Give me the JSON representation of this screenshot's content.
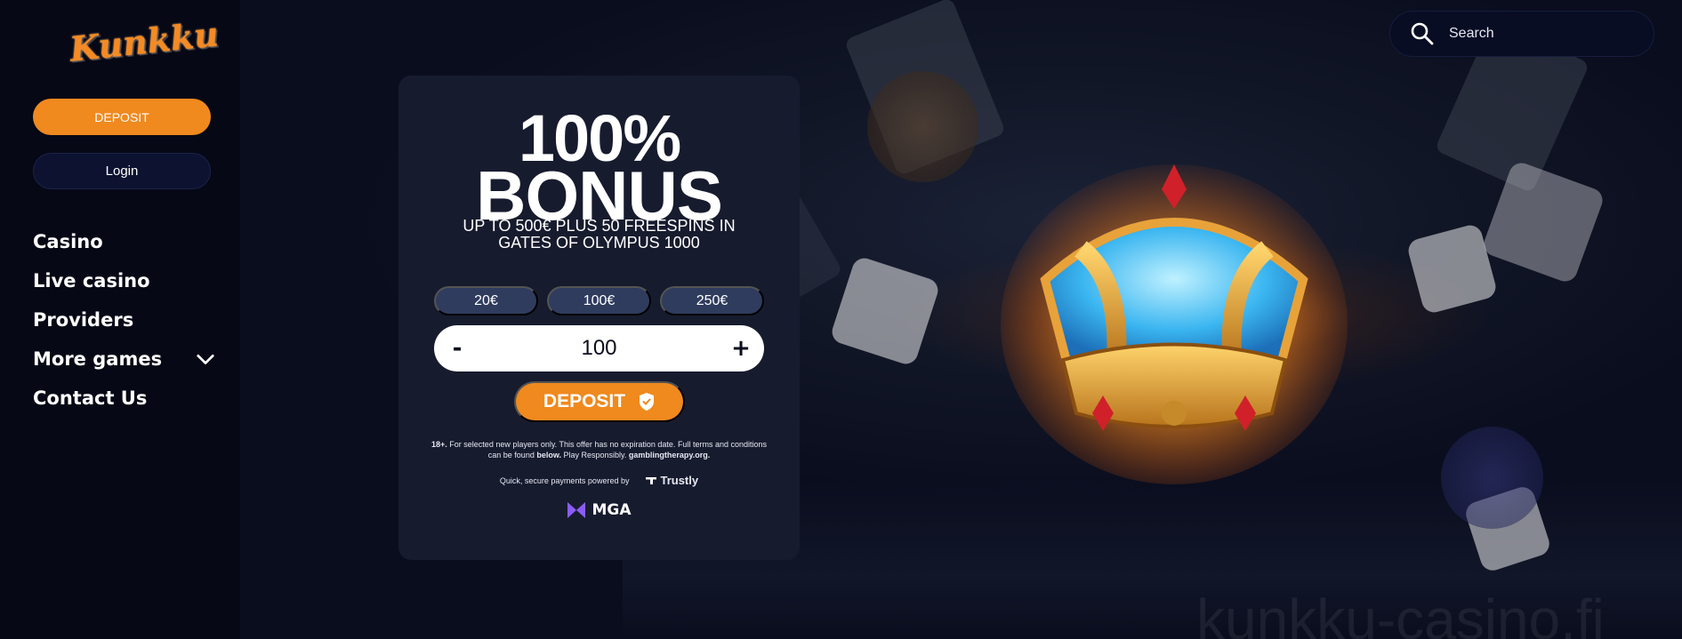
{
  "brand": {
    "logo_text": "Kunkku"
  },
  "sidebar": {
    "deposit_label": "DEPOSIT",
    "login_label": "Login",
    "nav": [
      {
        "label": "Casino"
      },
      {
        "label": "Live casino"
      },
      {
        "label": "Providers"
      },
      {
        "label": "More games",
        "has_dropdown": true
      },
      {
        "label": "Contact Us"
      }
    ]
  },
  "search": {
    "placeholder": "Search",
    "icon": "search-icon"
  },
  "bonus": {
    "percent": "100%",
    "title": "BONUS",
    "subtitle_line1": "UP TO 500€ PLUS 50 FREESPINS IN",
    "subtitle_line2": "GATES OF OLYMPUS 1000",
    "amounts": [
      "20€",
      "100€",
      "250€"
    ],
    "stepper": {
      "minus": "-",
      "value": "100",
      "plus": "+"
    },
    "deposit_label": "DEPOSIT",
    "fine_print": {
      "age": "18+.",
      "text1": " For selected new players only. This offer has no expiration date. Full terms and conditions can be found ",
      "below": "below.",
      "text2": " Play Responsibly. ",
      "link": "gamblingtherapy.org."
    },
    "payments_text": "Quick, secure payments powered by",
    "payment_provider": "Trustly",
    "license": "MGA"
  },
  "watermark": "kunkku-casino.fi",
  "colors": {
    "accent": "#f0891e",
    "background": "#0a0d1e",
    "card": "#171b2e",
    "amount_pill": "#2f3c5e"
  }
}
